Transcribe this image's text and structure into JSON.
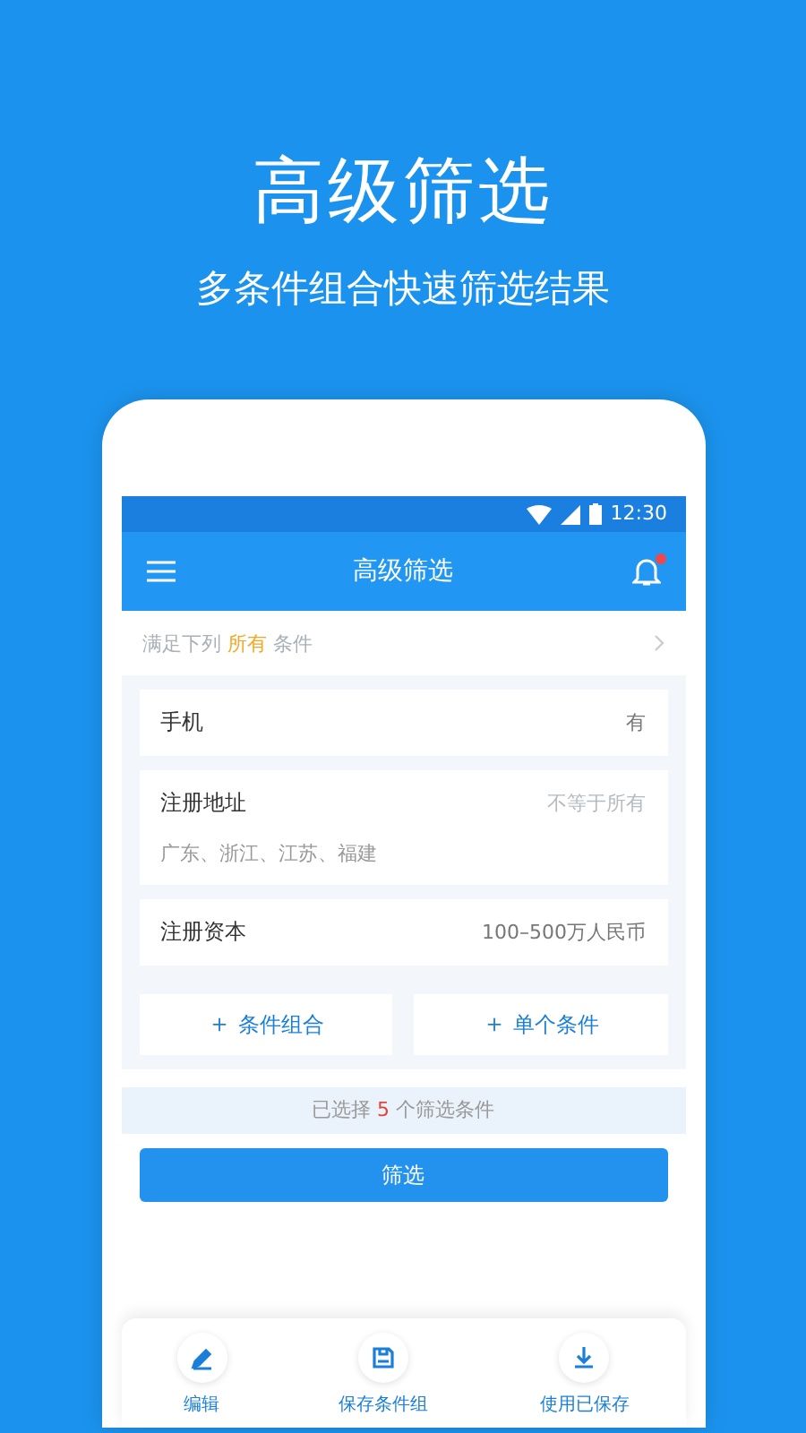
{
  "headline": "高级筛选",
  "subtitle": "多条件组合快速筛选结果",
  "status_bar": {
    "time": "12:30"
  },
  "app_bar": {
    "title": "高级筛选",
    "notification": true
  },
  "match_line": {
    "prefix": "满足下列",
    "highlight": "所有",
    "suffix": "条件"
  },
  "conditions": [
    {
      "name": "手机",
      "value": "有"
    },
    {
      "name": "注册地址",
      "value": "不等于所有",
      "detail": "广东、浙江、江苏、福建"
    },
    {
      "name": "注册资本",
      "value": "100–500万人民币"
    }
  ],
  "add_buttons": [
    {
      "icon": "＋",
      "label": "条件组合"
    },
    {
      "icon": "＋",
      "label": "单个条件"
    }
  ],
  "summary": {
    "prefix": "已选择",
    "count": "5",
    "suffix": "个筛选条件"
  },
  "filter_button": "筛选",
  "toolbar": [
    {
      "kind": "edit",
      "label": "编辑"
    },
    {
      "kind": "save",
      "label": "保存条件组"
    },
    {
      "kind": "download",
      "label": "使用已保存"
    }
  ]
}
